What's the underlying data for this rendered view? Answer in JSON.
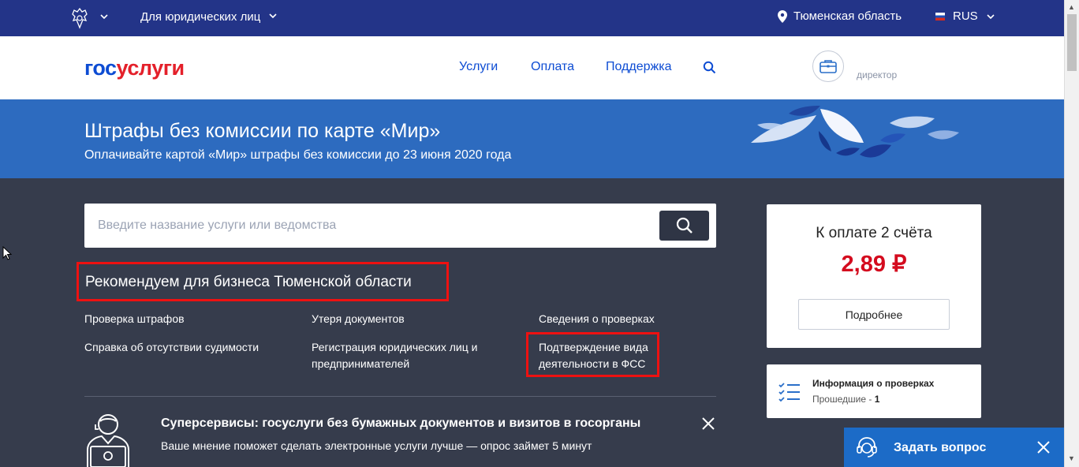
{
  "topbar": {
    "crest_icon": "coat-of-arms-icon",
    "legal_label": "Для юридических лиц",
    "region_label": "Тюменская область",
    "language": "RUS"
  },
  "header": {
    "logo_part1": "гос",
    "logo_part2": "услуги",
    "nav": [
      "Услуги",
      "Оплата",
      "Поддержка"
    ],
    "role": "директор"
  },
  "banner": {
    "title": "Штрафы без комиссии по карте «Мир»",
    "subtitle": "Оплачивайте картой «Мир» штрафы без комиссии до 23 июня 2020 года"
  },
  "search": {
    "placeholder": "Введите название услуги или ведомства"
  },
  "recommend": {
    "title": "Рекомендуем для бизнеса Тюменской области",
    "links": [
      "Проверка штрафов",
      "Справка об отсутствии судимости",
      "Утеря документов",
      "Регистрация юридических лиц и предпринимателей",
      "Сведения о проверках",
      "Подтверждение вида деятельности в ФСС"
    ]
  },
  "survey": {
    "title": "Суперсервисы: госуслуги без бумажных документов и визитов в госорганы",
    "text": "Ваше мнение поможет сделать электронные услуги лучше — опрос займет 5 минут"
  },
  "payment": {
    "title": "К оплате 2 счёта",
    "amount": "2,89 ₽",
    "button": "Подробнее"
  },
  "inspections": {
    "title": "Информация о проверках",
    "sub_label": "Прошедшие - ",
    "sub_count": "1"
  },
  "help": {
    "label": "Задать вопрос"
  },
  "colors": {
    "topbar": "#233488",
    "banner": "#2d6bbf",
    "content_bg": "#363c4c",
    "accent_red": "#d40b1e",
    "link_blue": "#0d4cd3"
  }
}
